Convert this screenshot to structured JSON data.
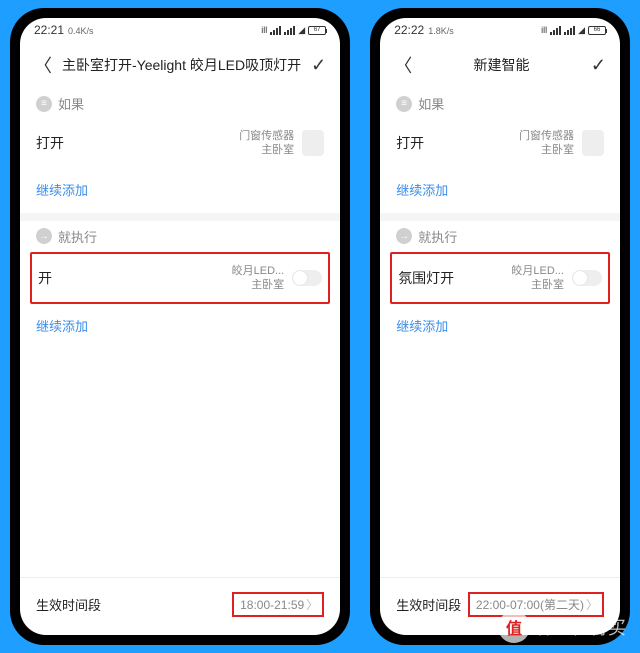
{
  "left": {
    "status": {
      "time": "22:21",
      "speed": "0.4K/s",
      "battery": "67"
    },
    "header": {
      "title": "主卧室打开-Yeelight 皎月LED吸顶灯开"
    },
    "if_label": "如果",
    "condition": {
      "name": "打开",
      "device": "门窗传感器",
      "room": "主卧室"
    },
    "add_more": "继续添加",
    "then_label": "就执行",
    "action": {
      "name": "开",
      "device": "皎月LED...",
      "room": "主卧室"
    },
    "footer": {
      "label": "生效时间段",
      "range": "18:00-21:59"
    }
  },
  "right": {
    "status": {
      "time": "22:22",
      "speed": "1.8K/s",
      "battery": "66"
    },
    "header": {
      "title": "新建智能"
    },
    "if_label": "如果",
    "condition": {
      "name": "打开",
      "device": "门窗传感器",
      "room": "主卧室"
    },
    "add_more": "继续添加",
    "then_label": "就执行",
    "action": {
      "name": "氛围灯开",
      "device": "皎月LED...",
      "room": "主卧室"
    },
    "footer": {
      "label": "生效时间段",
      "range": "22:00-07:00(第二天)"
    }
  },
  "watermark": "什么值得买"
}
